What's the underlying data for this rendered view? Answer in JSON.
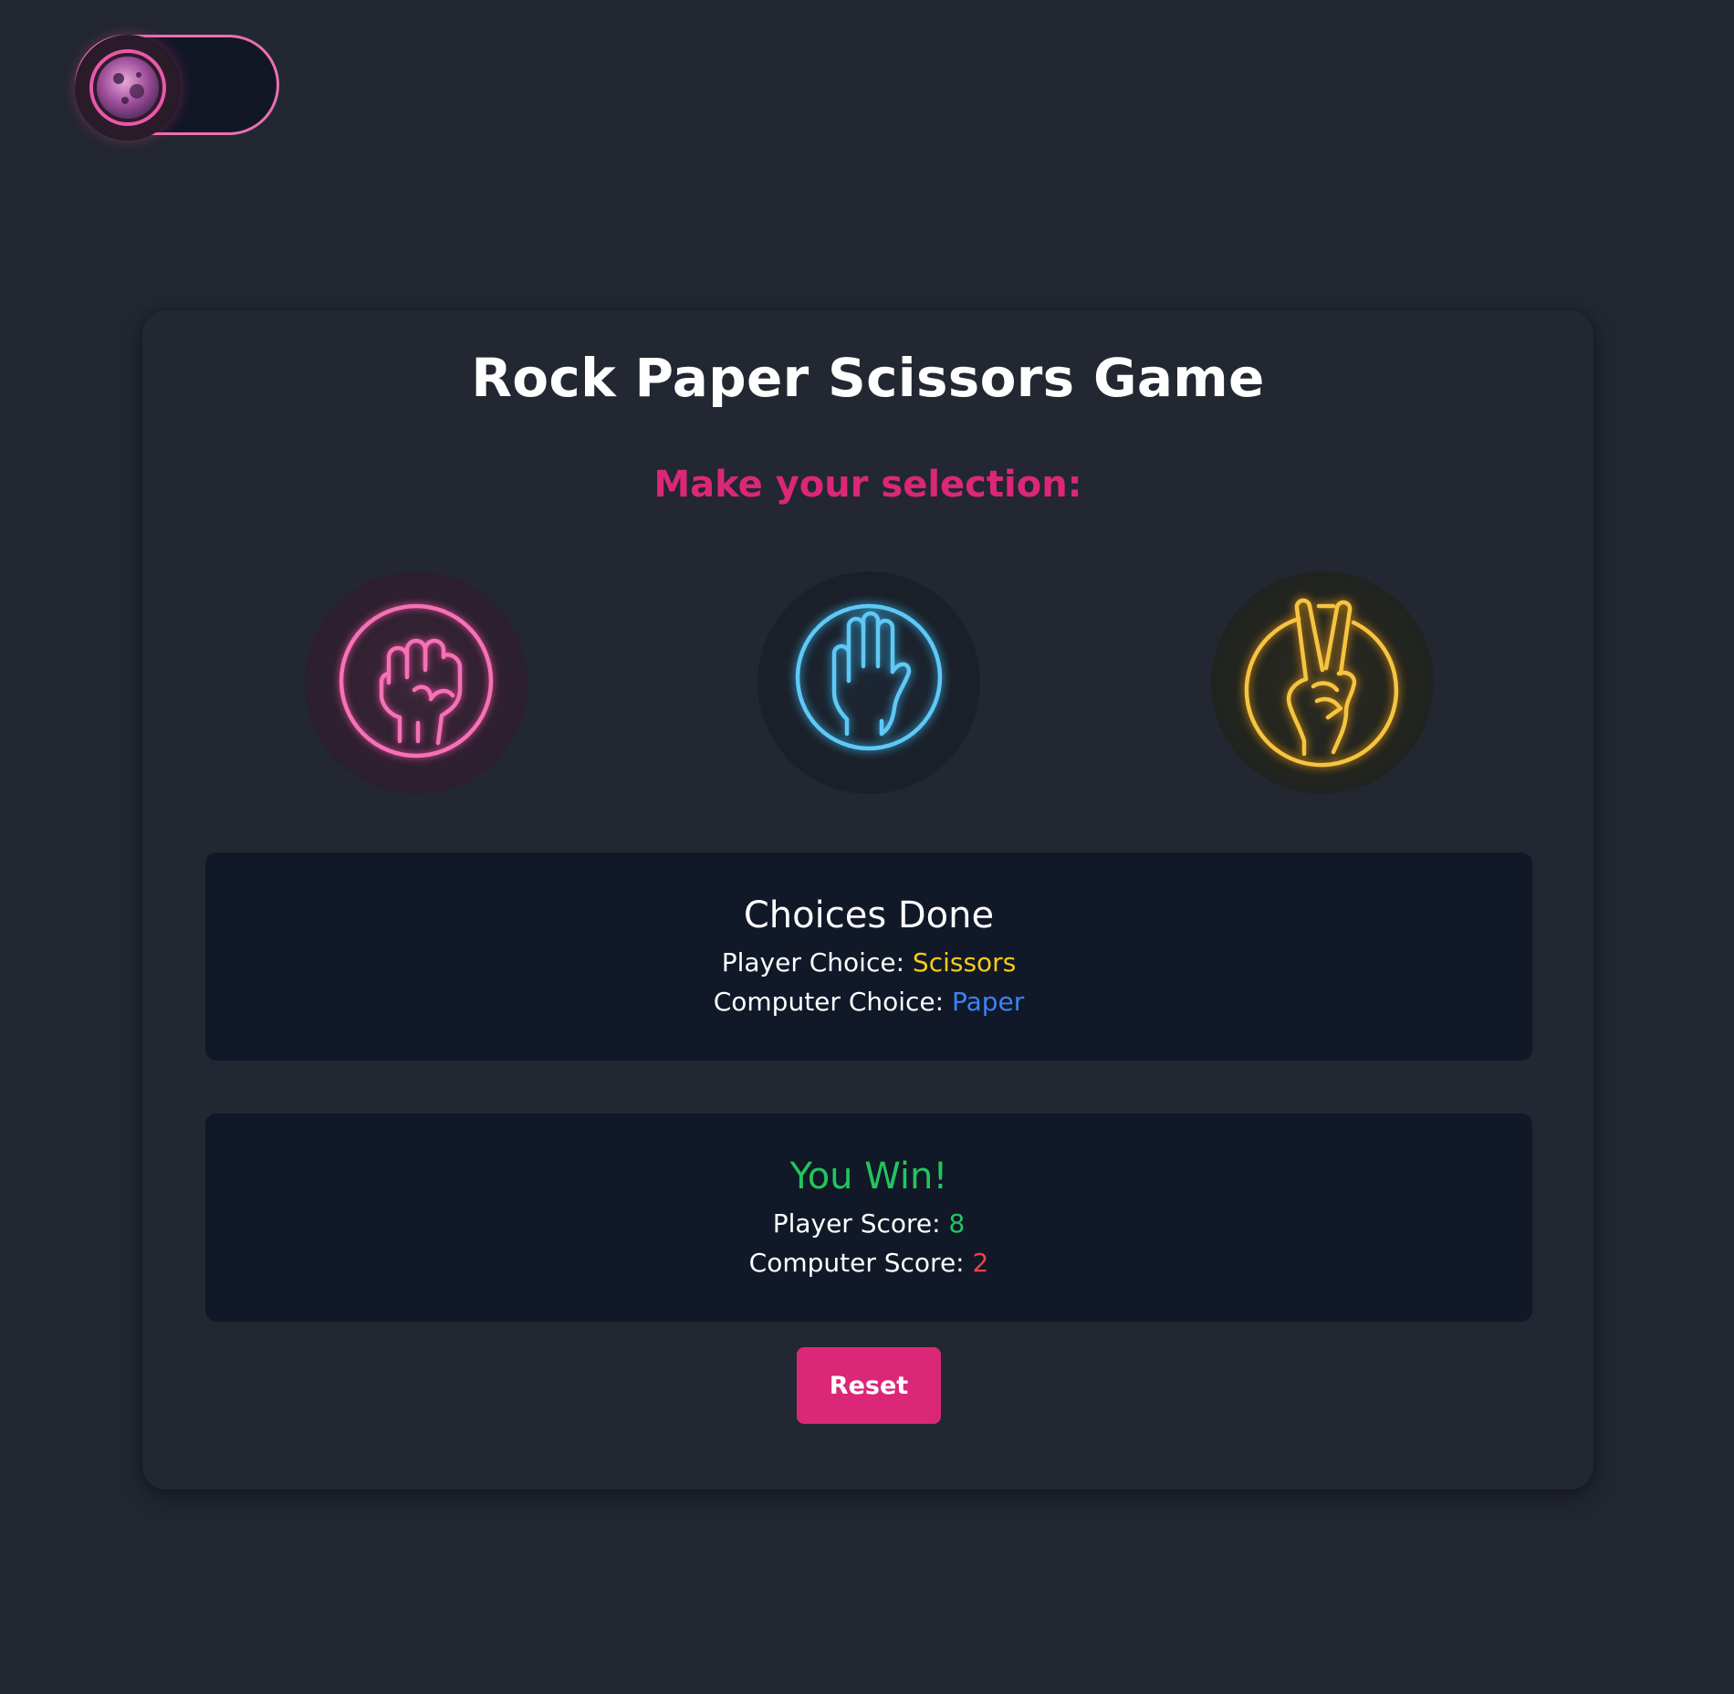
{
  "header": {
    "theme_toggle_icon": "moon-icon",
    "theme_mode": "dark"
  },
  "game": {
    "title": "Rock Paper Scissors Game",
    "subtitle": "Make your selection:",
    "choices": [
      {
        "name": "Rock",
        "icon": "fist-icon",
        "color": "#ec6fb1"
      },
      {
        "name": "Paper",
        "icon": "open-hand-icon",
        "color": "#5ec8f2"
      },
      {
        "name": "Scissors",
        "icon": "peace-sign-icon",
        "color": "#f5c542"
      }
    ]
  },
  "choices_panel": {
    "heading": "Choices Done",
    "player_label": "Player Choice: ",
    "player_value": "Scissors",
    "computer_label": "Computer Choice: ",
    "computer_value": "Paper"
  },
  "result_panel": {
    "heading": "You Win!",
    "player_label": "Player Score: ",
    "player_value": "8",
    "computer_label": "Computer Score: ",
    "computer_value": "2"
  },
  "reset_label": "Reset",
  "colors": {
    "background": "#222731",
    "panel": "#111827",
    "accent": "#db2777",
    "win": "#22c55e",
    "scissors": "#facc15",
    "paper": "#3b82f6",
    "computer_score": "#ef4444"
  }
}
